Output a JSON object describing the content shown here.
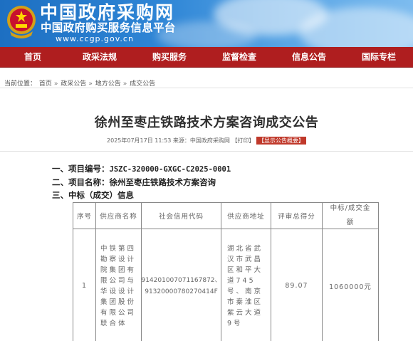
{
  "header": {
    "title": "中国政府采购网",
    "subtitle": "中国政府购买服务信息平台",
    "url": "www.ccgp.gov.cn"
  },
  "nav": {
    "items": [
      {
        "label": "首页"
      },
      {
        "label": "政采法规"
      },
      {
        "label": "购买服务"
      },
      {
        "label": "监督检查"
      },
      {
        "label": "信息公告"
      },
      {
        "label": "国际专栏"
      }
    ]
  },
  "breadcrumb": {
    "prefix": "当前位置：",
    "items": [
      "首页",
      "政采公告",
      "地方公告",
      "成交公告"
    ],
    "separator": "»"
  },
  "article": {
    "title": "徐州至枣庄铁路技术方案咨询成交公告",
    "meta_date": "2025年07月17日 11:53",
    "meta_source_label": "来源：",
    "meta_source": "中国政府采购网",
    "meta_print": "【打印】",
    "meta_tag": "【显示公告概要】",
    "sections": [
      {
        "label": "一、项目编号：",
        "value": "JSZC-320000-GXGC-C2025-0001"
      },
      {
        "label": "二、项目名称：",
        "value": "徐州至枣庄铁路技术方案咨询"
      },
      {
        "label": "三、中标（成交）信息",
        "value": ""
      }
    ]
  },
  "table": {
    "headers": [
      "序号",
      "供应商名称",
      "社会信用代码",
      "供应商地址",
      "评审总得分",
      "中标/成交金额"
    ],
    "rows": [
      {
        "no": "1",
        "supplier": "中铁第四勘察设计院集团有限公司与华设设计集团股份有限公司联合体",
        "credit_code": "914201007071167872、91320000780270414F",
        "address": "湖北省武汉市武昌区和平大道745号、南京市秦淮区紫云大道9号",
        "score": "89.07",
        "amount": "1060000元"
      }
    ]
  },
  "colors": {
    "nav_bg": "#af1e1f",
    "banner_blue": "#2f86d6",
    "tag_red": "#c0392b"
  }
}
